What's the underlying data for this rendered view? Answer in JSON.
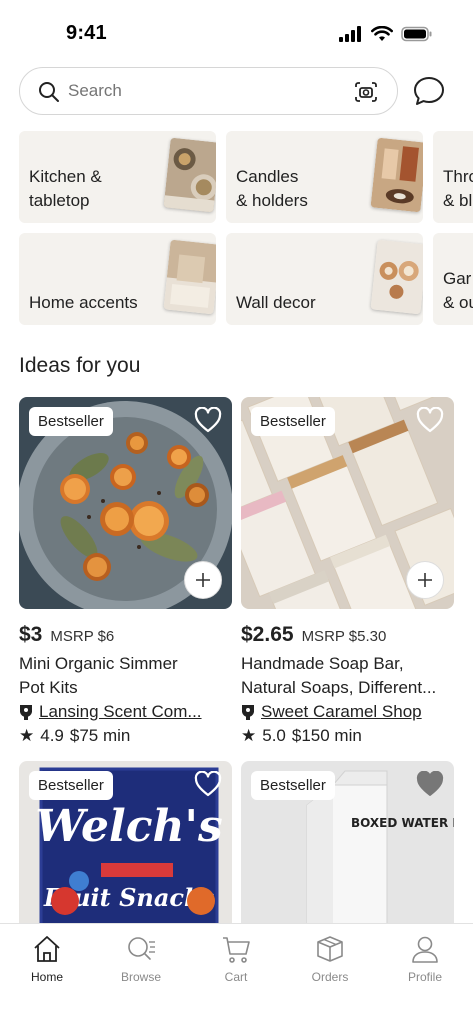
{
  "status": {
    "time": "9:41"
  },
  "search": {
    "placeholder": "Search"
  },
  "categories": [
    {
      "label_line1": "Kitchen &",
      "label_line2": "tabletop"
    },
    {
      "label_line1": "Candles",
      "label_line2": "& holders"
    },
    {
      "label_line1": "Thro",
      "label_line2": "& bl"
    },
    {
      "label_line1": "Home accents",
      "label_line2": ""
    },
    {
      "label_line1": "Wall decor",
      "label_line2": ""
    },
    {
      "label_line1": "Gar",
      "label_line2": "& ou"
    }
  ],
  "section": {
    "title": "Ideas for you"
  },
  "products": [
    {
      "badge": "Bestseller",
      "price": "$3",
      "msrp": "MSRP $6",
      "title_line1": "Mini Organic Simmer",
      "title_line2": "Pot Kits",
      "shop": "Lansing Scent Com...",
      "rating": "4.9",
      "minimum": "$75 min"
    },
    {
      "badge": "Bestseller",
      "price": "$2.65",
      "msrp": "MSRP $5.30",
      "title_line1": "Handmade Soap Bar,",
      "title_line2": "Natural Soaps, Different...",
      "shop": "Sweet Caramel Shop",
      "rating": "5.0",
      "minimum": "$150 min"
    },
    {
      "badge": "Bestseller",
      "packaging_text": "Welch's",
      "packaging_sub": "Fruit Snacks"
    },
    {
      "badge": "Bestseller",
      "packaging_text": "BOXED WATER IS BETTER."
    }
  ],
  "tabs": [
    {
      "label": "Home",
      "icon": "home-icon",
      "active": true
    },
    {
      "label": "Browse",
      "icon": "browse-icon",
      "active": false
    },
    {
      "label": "Cart",
      "icon": "cart-icon",
      "active": false
    },
    {
      "label": "Orders",
      "icon": "orders-icon",
      "active": false
    },
    {
      "label": "Profile",
      "icon": "profile-icon",
      "active": false
    }
  ],
  "colors": {
    "tile_bg": "#f4f2ee",
    "text": "#1f1f1f",
    "muted": "#8a8a8a"
  }
}
